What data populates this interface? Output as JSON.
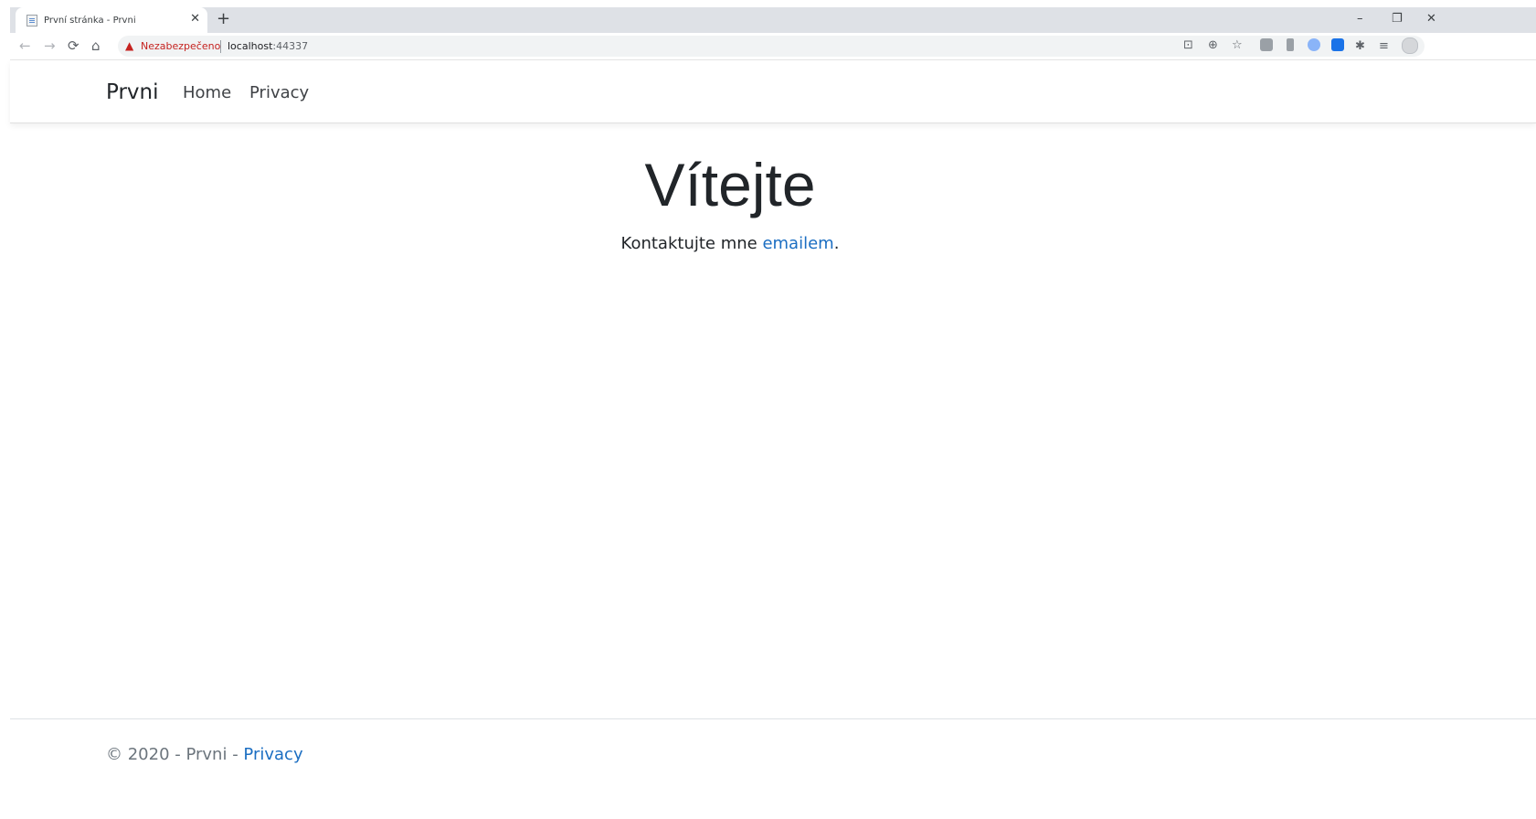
{
  "browser": {
    "tab_title": "První stránka - Prvni",
    "security_text": "Nezabezpečeno",
    "url_host": "localhost",
    "url_port": ":44337",
    "minimize_glyph": "–",
    "restore_glyph": "❐",
    "close_glyph": "✕"
  },
  "navbar": {
    "brand": "Prvni",
    "links": [
      "Home",
      "Privacy"
    ]
  },
  "main": {
    "heading": "Vítejte",
    "contact_prefix": "Kontaktujte mne ",
    "contact_link": "emailem",
    "contact_suffix": "."
  },
  "footer": {
    "copyright": "© 2020 - Prvni - ",
    "privacy_link": "Privacy"
  },
  "colors": {
    "link": "#1b6ec2",
    "warning": "#c5221f",
    "tabstrip": "#dee1e6"
  }
}
